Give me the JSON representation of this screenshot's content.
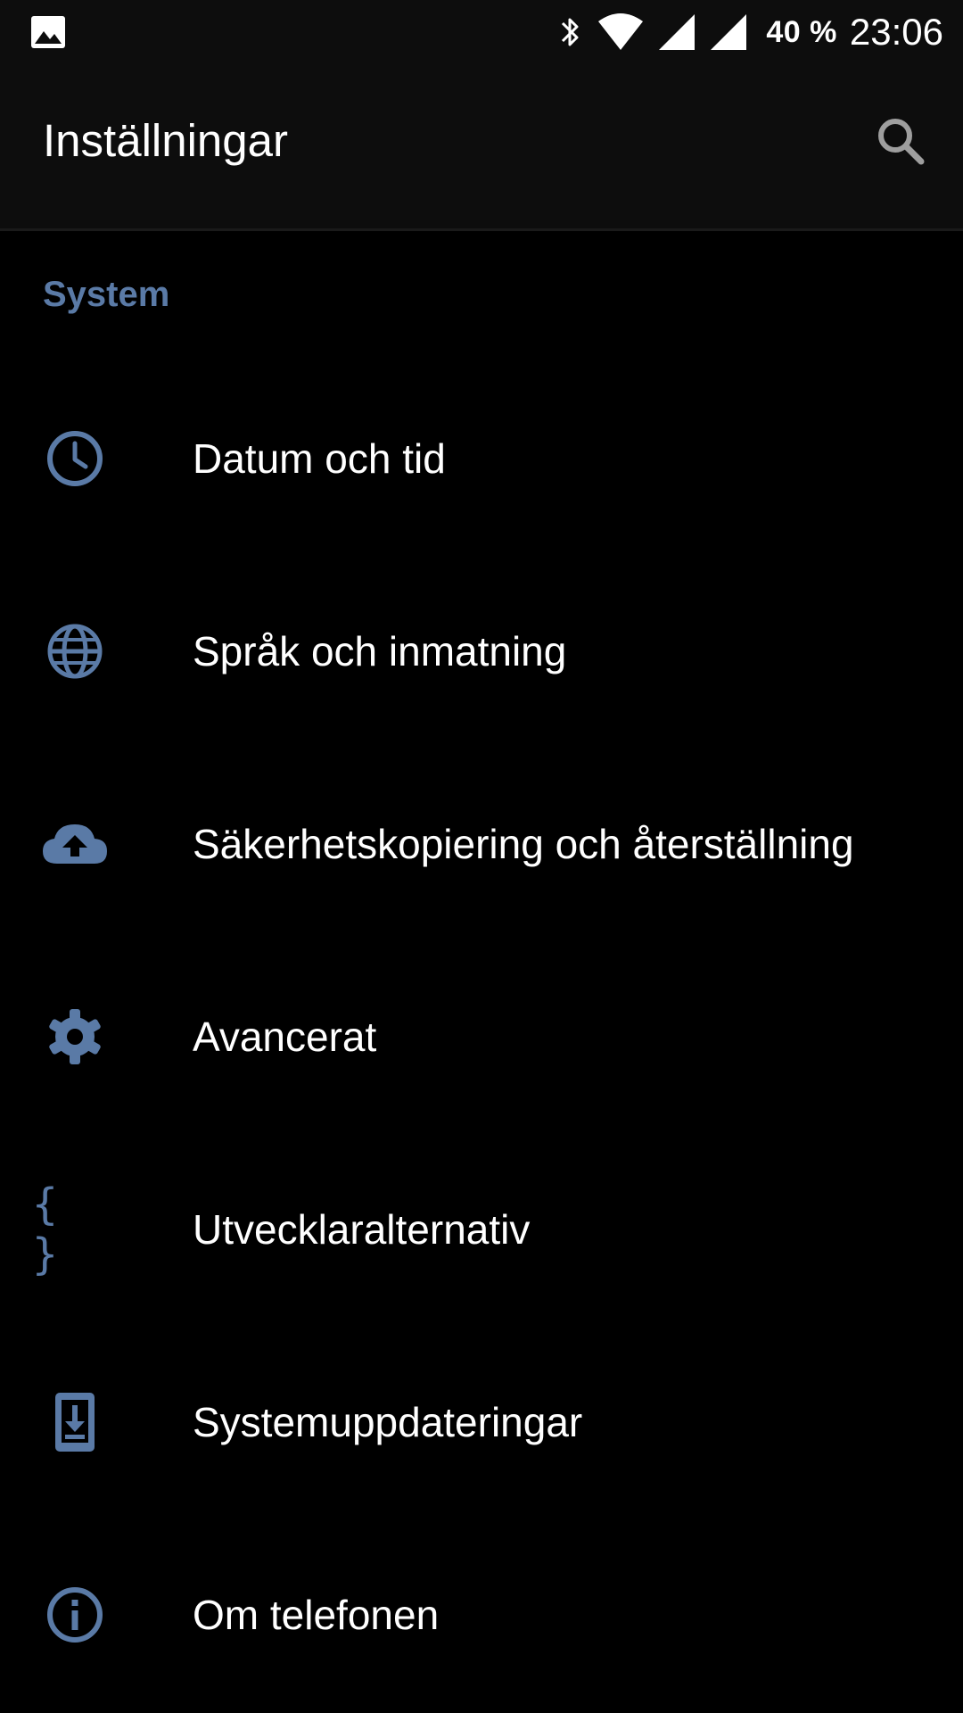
{
  "colors": {
    "accent": "#5a7aa6",
    "background": "#000000",
    "toolbar": "#0d0d0d",
    "text": "#ffffff"
  },
  "status_bar": {
    "left_icon": "image-notification-icon",
    "icons": [
      "bluetooth-icon",
      "wifi-icon",
      "cell-signal-icon",
      "cell-signal-icon"
    ],
    "battery": "40 %",
    "time": "23:06"
  },
  "toolbar": {
    "title": "Inställningar",
    "search_icon": "search-icon"
  },
  "section": {
    "title": "System"
  },
  "items": [
    {
      "icon": "clock-icon",
      "label": "Datum och tid"
    },
    {
      "icon": "globe-icon",
      "label": "Språk och inmatning"
    },
    {
      "icon": "cloud-upload-icon",
      "label": "Säkerhetskopiering och återställning"
    },
    {
      "icon": "gear-icon",
      "label": "Avancerat"
    },
    {
      "icon": "braces-icon",
      "label": "Utvecklaralternativ",
      "glyph": "{ }"
    },
    {
      "icon": "system-update-icon",
      "label": "Systemuppdateringar"
    },
    {
      "icon": "info-icon",
      "label": "Om telefonen"
    }
  ]
}
